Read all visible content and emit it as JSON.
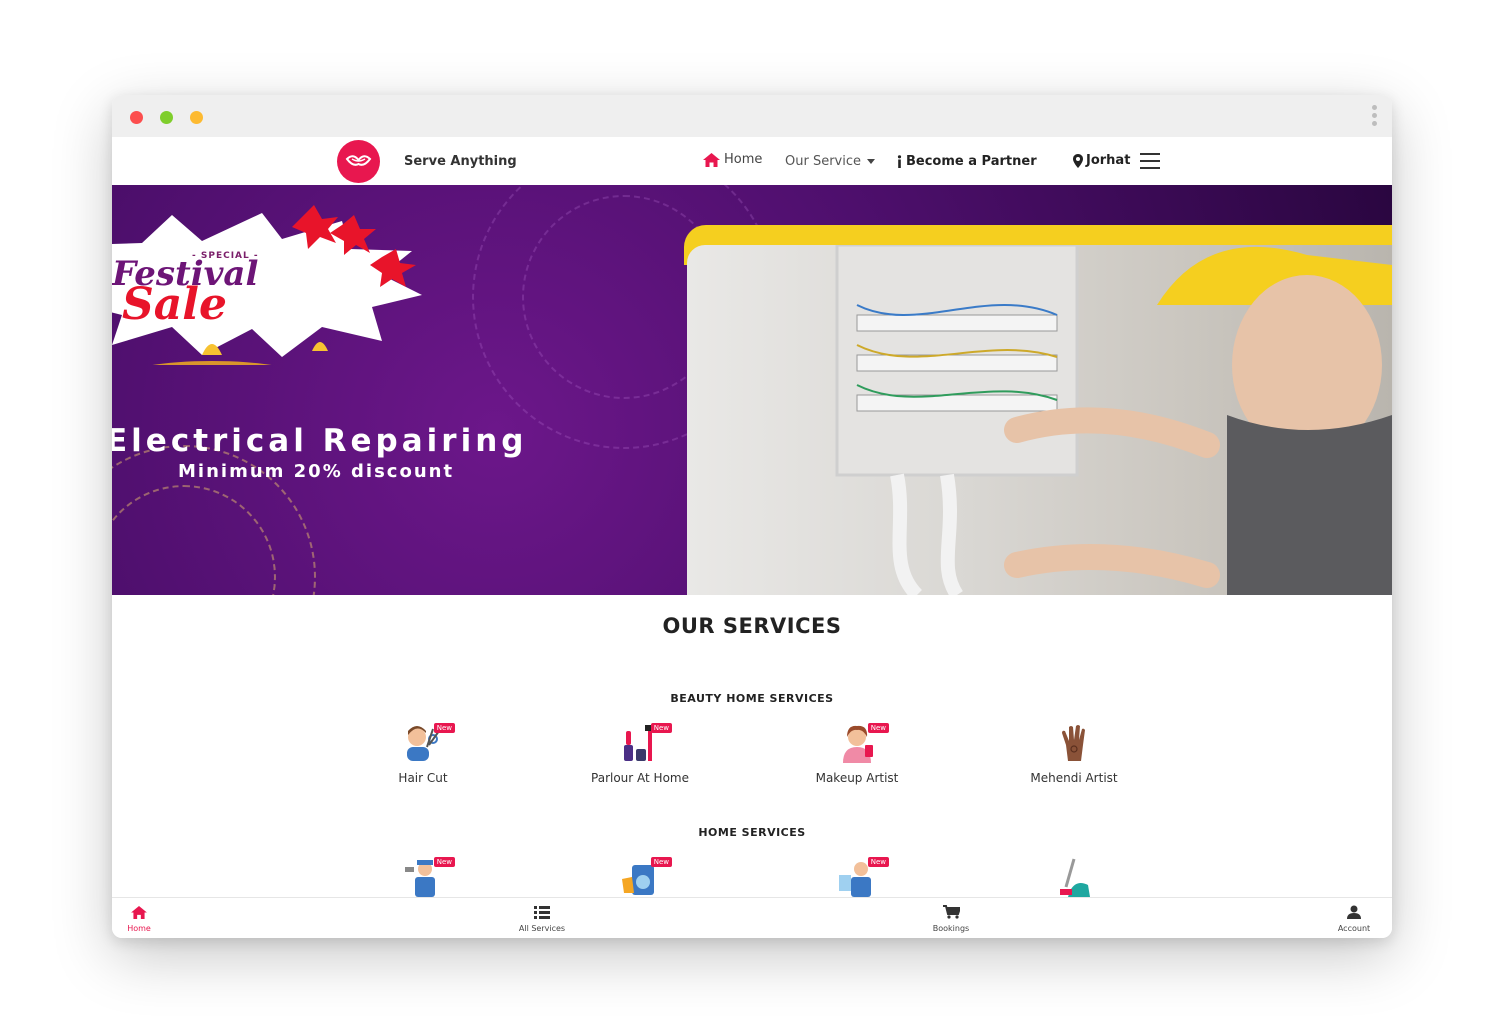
{
  "brand": {
    "name": "Serve Anything",
    "accent": "#e8174f"
  },
  "nav": {
    "home": "Home",
    "our_service": "Our Service",
    "become_partner": "Become a Partner",
    "location": "Jorhat"
  },
  "hero": {
    "special": "- SPECIAL -",
    "festival": "Festival",
    "sale": "Sale",
    "title": "Electrical Repairing",
    "subtitle": "Minimum 20% discount"
  },
  "services": {
    "heading": "OUR SERVICES",
    "badge": "New",
    "beauty": {
      "title": "BEAUTY HOME SERVICES",
      "items": [
        {
          "label": "Hair Cut",
          "icon": "haircut-icon"
        },
        {
          "label": "Parlour At Home",
          "icon": "cosmetics-icon"
        },
        {
          "label": "Makeup Artist",
          "icon": "makeup-artist-icon"
        },
        {
          "label": "Mehendi Artist",
          "icon": "mehendi-hand-icon"
        }
      ]
    },
    "home": {
      "title": "HOME SERVICES"
    }
  },
  "bottom_nav": {
    "home": "Home",
    "all_services": "All Services",
    "bookings": "Bookings",
    "account": "Account"
  }
}
